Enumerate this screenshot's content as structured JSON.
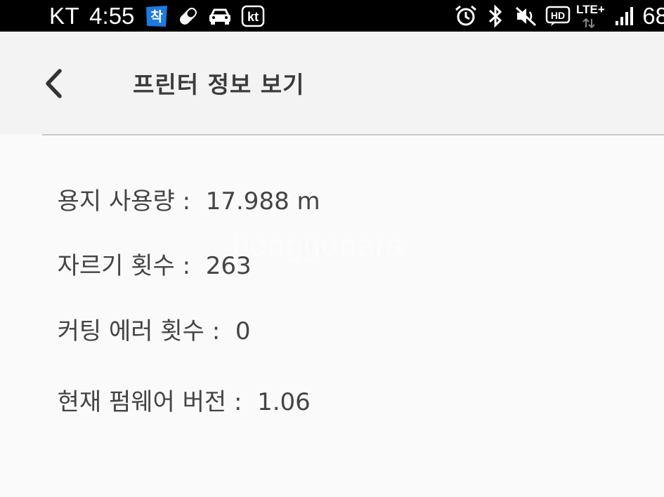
{
  "status_bar": {
    "carrier": "KT",
    "time": "4:55",
    "notification_icons": [
      "chak-app-icon",
      "pill-icon",
      "car-icon",
      "kt-app-icon"
    ],
    "system_icons": [
      "alarm-icon",
      "bluetooth-icon",
      "mute-icon",
      "hd-voice-icon",
      "lte-icon",
      "signal-icon"
    ],
    "lte_label": "LTE+",
    "hd_label": "HD",
    "chak_label": "착",
    "kt_label": "kt",
    "battery": "68",
    "colors": {
      "background": "#000000",
      "text": "#ffffff",
      "chak_badge": "#1e7ae0"
    }
  },
  "app_bar": {
    "back_icon": "chevron-left-icon",
    "title": "프린터 정보 보기",
    "background": "#f3f3f3"
  },
  "info": {
    "separator": " :  ",
    "rows": [
      {
        "label": "용지 사용량",
        "value": "17.988 m"
      },
      {
        "label": "자르기 횟수",
        "value": "263"
      },
      {
        "label": "커팅 에러 횟수",
        "value": "0"
      },
      {
        "label": "현재 펌웨어 버전",
        "value": "1.06"
      }
    ]
  },
  "watermark": "bonggonara"
}
